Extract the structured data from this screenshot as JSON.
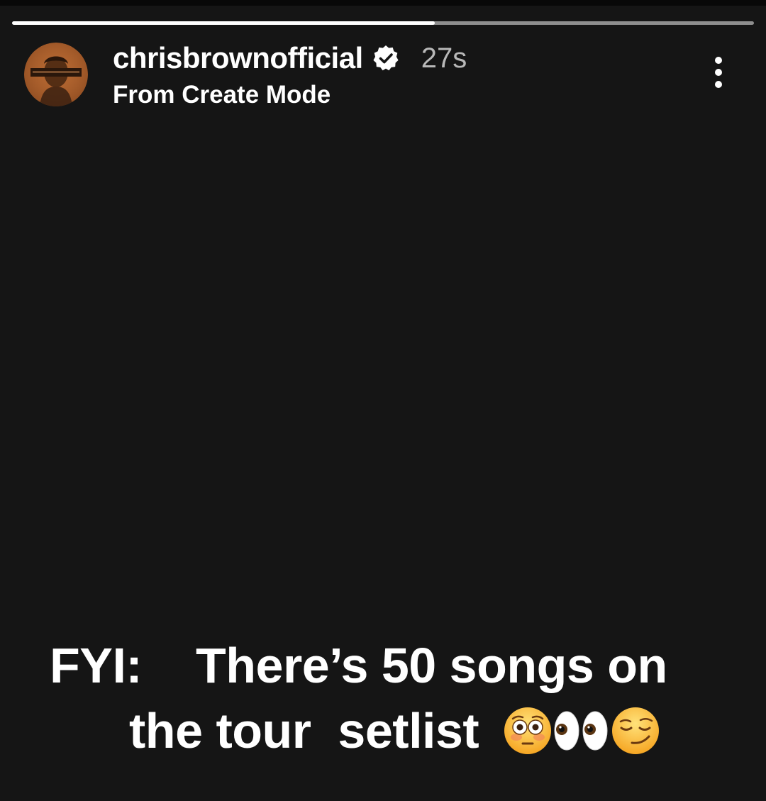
{
  "story": {
    "progress": 0.57,
    "colors": {
      "background": "#151515",
      "progress_filled": "#ffffff",
      "progress_track": "#8e8e8e",
      "avatar_bg": "#b5652e"
    }
  },
  "header": {
    "username": "chrisbrownofficial",
    "verified": true,
    "verified_icon": "verified-badge-icon",
    "timestamp": "27s",
    "subtitle": "From Create Mode",
    "more_icon": "more-vertical-icon"
  },
  "caption": {
    "line1_label": "FYI:",
    "line1_text": "There’s 50 songs on",
    "line2_text": "the tour  setlist",
    "emojis": [
      "flushed-face-emoji",
      "eyes-emoji",
      "smirking-face-emoji"
    ]
  }
}
